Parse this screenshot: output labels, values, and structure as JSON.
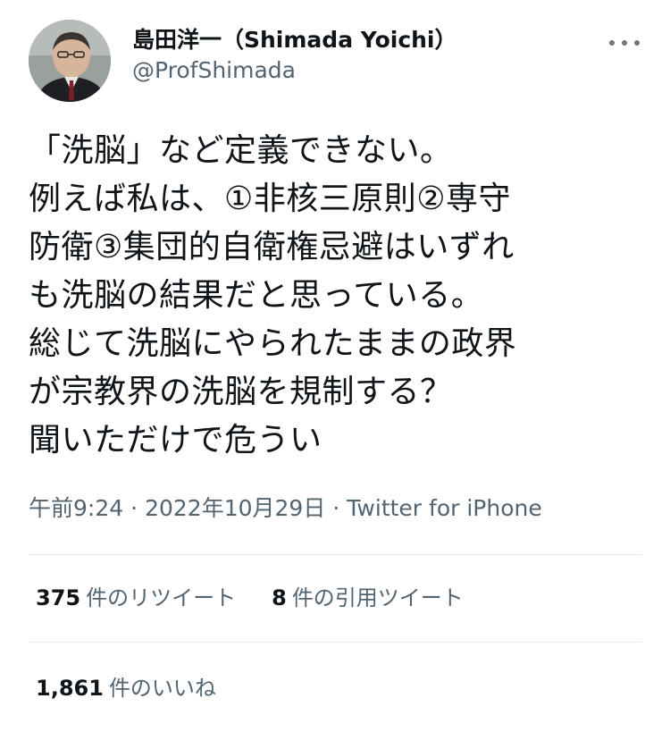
{
  "author": {
    "display_name": "島田洋一（Shimada Yoichi）",
    "handle": "@ProfShimada",
    "avatar_icon": "user-photo-avatar"
  },
  "tweet": {
    "lines": [
      "「洗脳」など定義できない。",
      "例えば私は、①非核三原則②専守",
      "防衛③集団的自衛権忌避はいずれ",
      "も洗脳の結果だと思っている。",
      "総じて洗脳にやられたままの政界",
      "が宗教界の洗脳を規制する？",
      "聞いただけで危うい"
    ]
  },
  "meta": {
    "time": "午前9:24",
    "separator": "·",
    "date": "2022年10月29日",
    "source": "Twitter for iPhone"
  },
  "stats": {
    "retweets_count": "375",
    "retweets_label": "件のリツイート",
    "quotes_count": "8",
    "quotes_label": "件の引用ツイート",
    "likes_count": "1,861",
    "likes_label": "件のいいね"
  },
  "colors": {
    "text_primary": "#0f1419",
    "text_secondary": "#536471",
    "divider": "#e6ecf0"
  }
}
